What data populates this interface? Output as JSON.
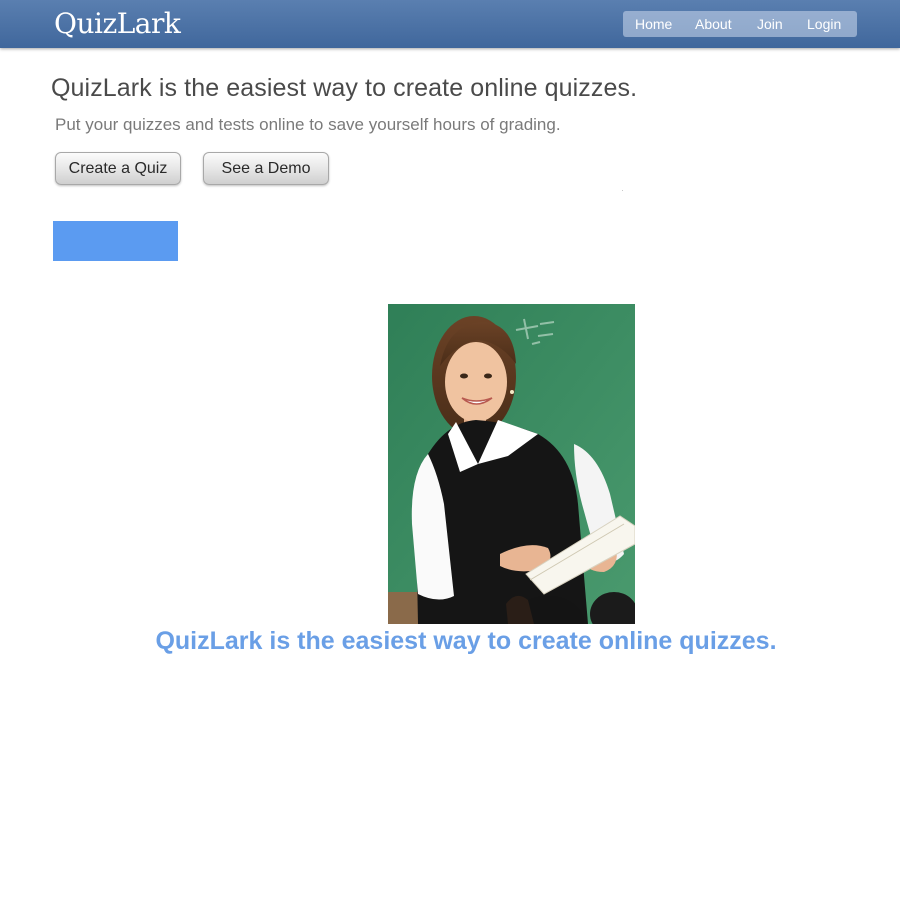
{
  "site": {
    "logo_text": "QuizLark"
  },
  "nav": {
    "items": [
      {
        "label": "Home"
      },
      {
        "label": "About"
      },
      {
        "label": "Join"
      },
      {
        "label": "Login"
      }
    ]
  },
  "hero": {
    "headline": "QuizLark is the easiest way to create online quizzes.",
    "subheadline": "Put your quizzes and tests online to save yourself hours of grading.",
    "buttons": {
      "create_label": "Create a Quiz",
      "demo_label": "See a Demo"
    }
  },
  "tagline": {
    "text": "QuizLark is the easiest way to create online quizzes."
  },
  "colors": {
    "header_top": "#5a7fb0",
    "header_bottom": "#40679c",
    "blue_block": "#5b9bf1",
    "tagline": "#6a9fe6",
    "chalkboard": "#3e8a63"
  },
  "icons": {
    "photo": "teacher-photo"
  }
}
